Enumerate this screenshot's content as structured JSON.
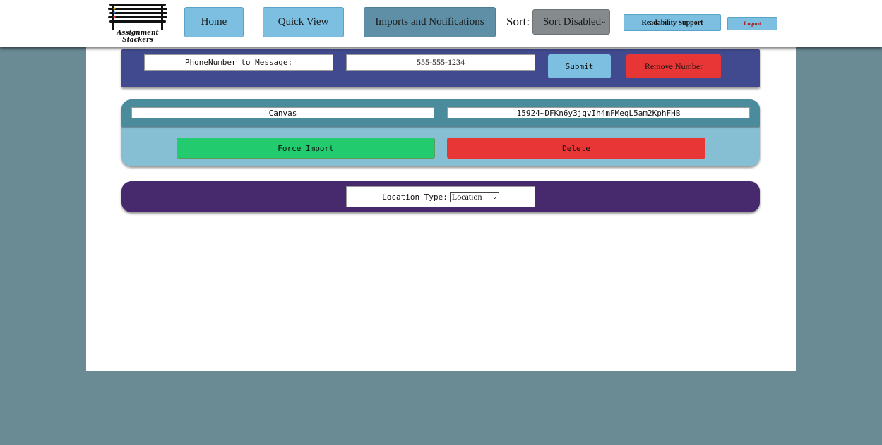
{
  "header": {
    "logo_text": "Assignment Stackers",
    "nav": {
      "home": "Home",
      "quick_view": "Quick View",
      "imports": "Imports and Notifications"
    },
    "sort_label": "Sort:",
    "sort_value": "Sort Disabled",
    "readability": "Readability Support",
    "logout": "Logout"
  },
  "phone_panel": {
    "label": "PhoneNumber to Message:",
    "number": "555-555-1234",
    "submit": "Submit",
    "remove": "Remove Number"
  },
  "import_panel": {
    "source": "Canvas",
    "token": "15924~DFKn6y3jqvIh4mFMeqL5am2KphFHB",
    "force_import": "Force Import",
    "delete": "Delete"
  },
  "location_panel": {
    "label": "Location Type:",
    "selected": "Location"
  },
  "colors": {
    "background": "#6a8a94",
    "nav_button": "#7cbfe0",
    "nav_active": "#5e8fa6",
    "phone_panel": "#414a8e",
    "import_header": "#4a8c9c",
    "import_body": "#86bfd4",
    "location_panel": "#472a6e",
    "danger": "#e83535",
    "success": "#22cc6e"
  }
}
